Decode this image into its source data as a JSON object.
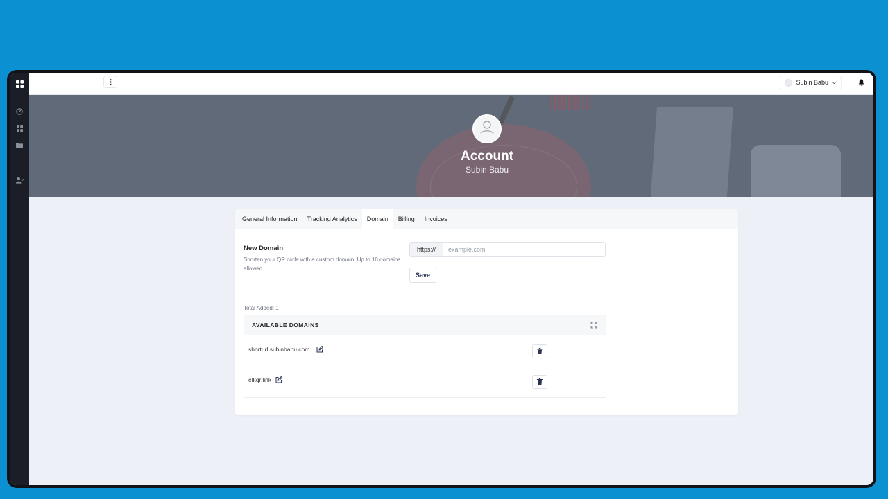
{
  "user": {
    "name": "Subin Babu"
  },
  "sidebar": {
    "icons": [
      "apps-icon",
      "dashboard-gauge-icon",
      "grid-icon",
      "folder-icon",
      "user-check-icon"
    ]
  },
  "hero": {
    "title": "Account",
    "subtitle": "Subin Babu"
  },
  "tabs": [
    {
      "label": "General Information",
      "active": false
    },
    {
      "label": "Tracking Analytics",
      "active": false
    },
    {
      "label": "Domain",
      "active": true
    },
    {
      "label": "Billing",
      "active": false
    },
    {
      "label": "Invoices",
      "active": false
    }
  ],
  "new_domain": {
    "title": "New Domain",
    "description": "Shorten your QR code with a custom domain. Up to 10 domains allowed.",
    "prefix": "https://",
    "placeholder": "example.com",
    "value": "",
    "save_label": "Save"
  },
  "domains": {
    "total_label": "Total Added: 1",
    "header": "AVAILABLE DOMAINS",
    "items": [
      {
        "name": "shorturl.subinbabu.com"
      },
      {
        "name": "elkqr.link"
      }
    ]
  },
  "colors": {
    "background": "#0b91d1",
    "sidebar": "#1b1e27",
    "accent": "#2a3354"
  }
}
